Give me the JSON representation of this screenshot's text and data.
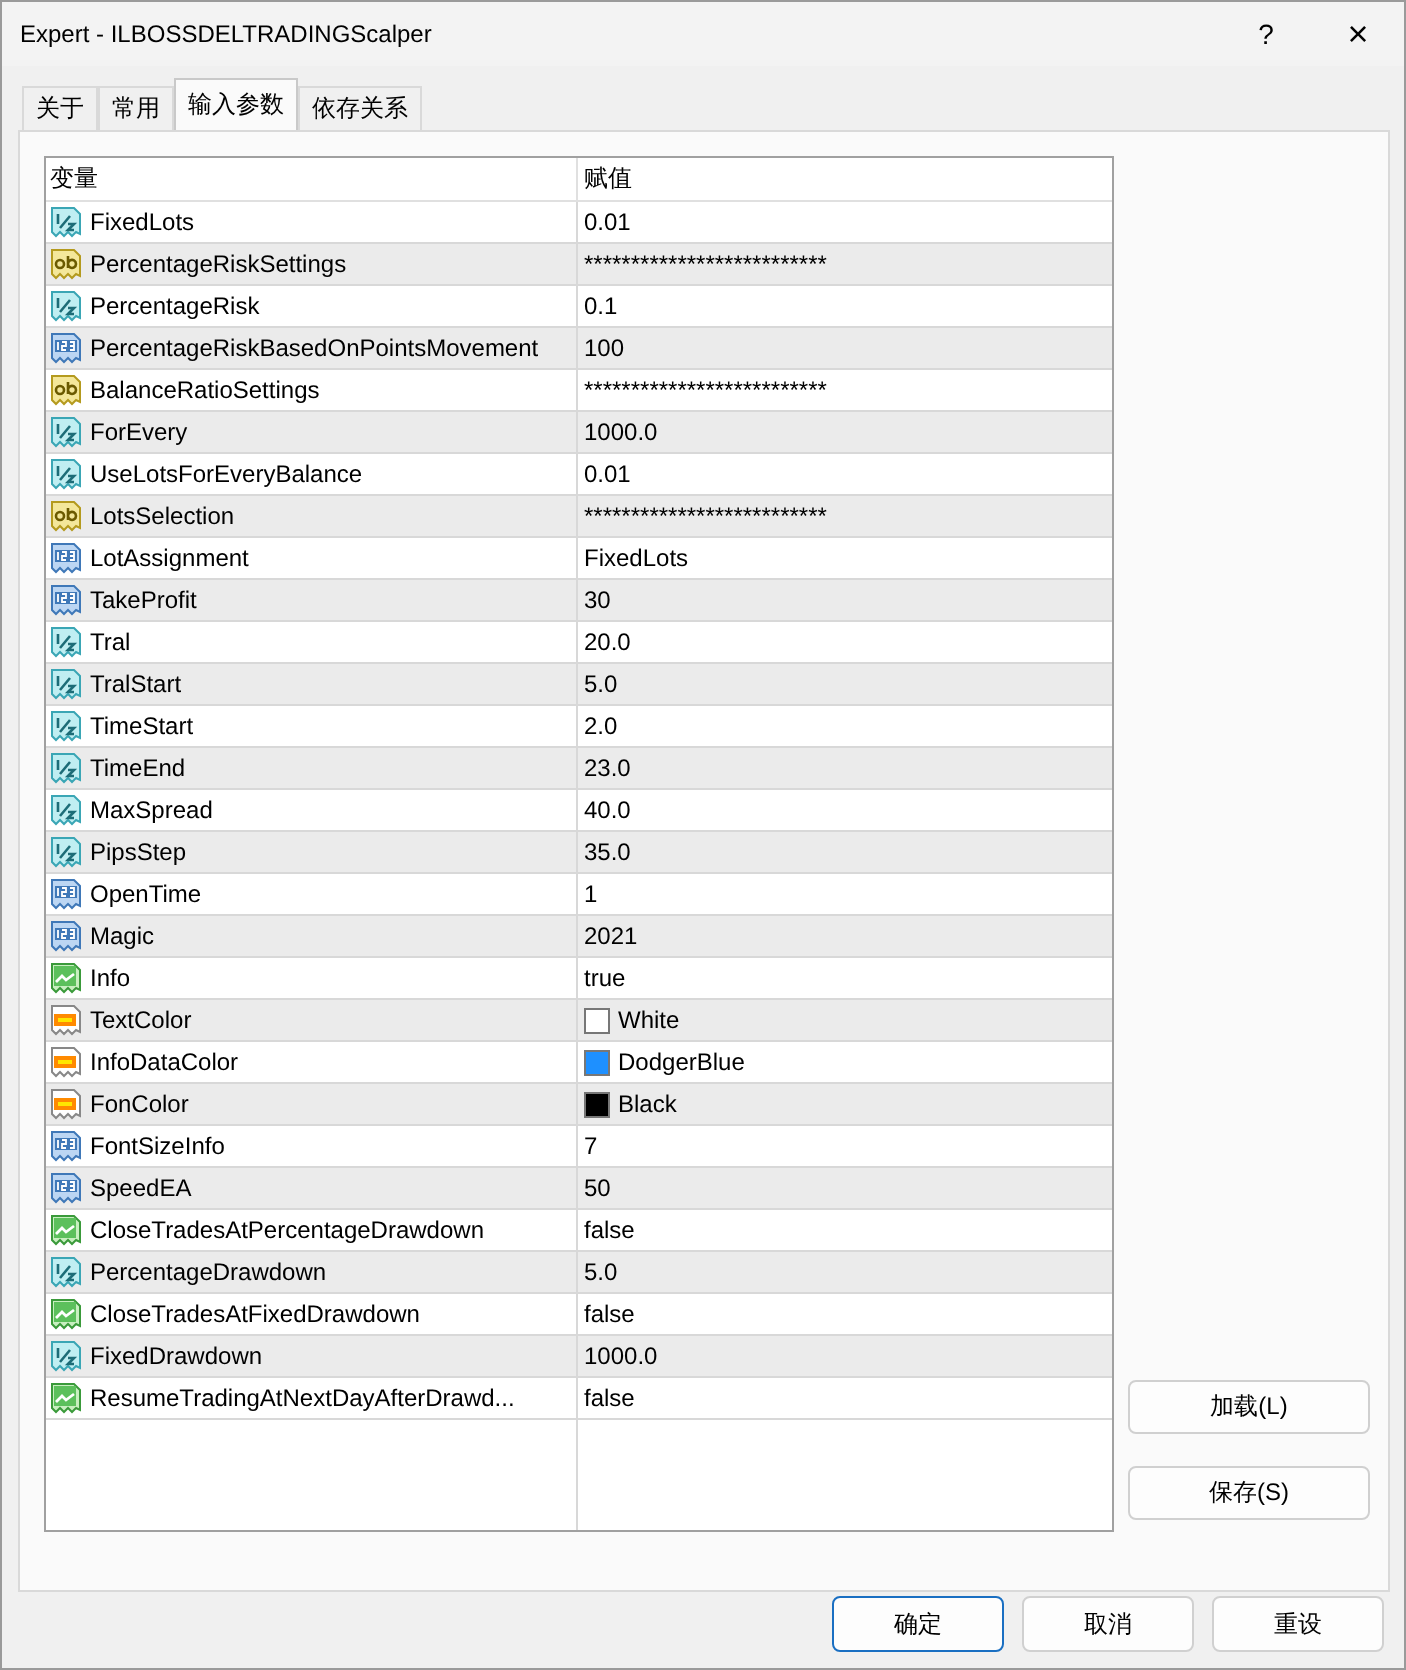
{
  "window": {
    "title": "Expert - ILBOSSDELTRADINGScalper",
    "help": "?",
    "close": "×"
  },
  "tabs": [
    {
      "label": "关于",
      "selected": false
    },
    {
      "label": "常用",
      "selected": false
    },
    {
      "label": "输入参数",
      "selected": true
    },
    {
      "label": "依存关系",
      "selected": false
    }
  ],
  "table": {
    "columns": [
      "变量",
      "赋值"
    ],
    "rows": [
      {
        "kind": "double",
        "name": "FixedLots",
        "value": "0.01"
      },
      {
        "kind": "string",
        "name": "PercentageRiskSettings",
        "value": "**************************"
      },
      {
        "kind": "double",
        "name": "PercentageRisk",
        "value": "0.1"
      },
      {
        "kind": "int",
        "name": "PercentageRiskBasedOnPointsMovement",
        "value": "100"
      },
      {
        "kind": "string",
        "name": "BalanceRatioSettings",
        "value": "**************************"
      },
      {
        "kind": "double",
        "name": "ForEvery",
        "value": "1000.0"
      },
      {
        "kind": "double",
        "name": "UseLotsForEveryBalance",
        "value": "0.01"
      },
      {
        "kind": "string",
        "name": "LotsSelection",
        "value": "**************************"
      },
      {
        "kind": "int",
        "name": "LotAssignment",
        "value": "FixedLots"
      },
      {
        "kind": "int",
        "name": "TakeProfit",
        "value": "30"
      },
      {
        "kind": "double",
        "name": "Tral",
        "value": "20.0"
      },
      {
        "kind": "double",
        "name": "TralStart",
        "value": "5.0"
      },
      {
        "kind": "double",
        "name": "TimeStart",
        "value": "2.0"
      },
      {
        "kind": "double",
        "name": "TimeEnd",
        "value": "23.0"
      },
      {
        "kind": "double",
        "name": "MaxSpread",
        "value": "40.0"
      },
      {
        "kind": "double",
        "name": "PipsStep",
        "value": "35.0"
      },
      {
        "kind": "int",
        "name": "OpenTime",
        "value": "1"
      },
      {
        "kind": "int",
        "name": "Magic",
        "value": "2021"
      },
      {
        "kind": "bool",
        "name": "Info",
        "value": "true"
      },
      {
        "kind": "color",
        "name": "TextColor",
        "value": "White",
        "color": "#ffffff"
      },
      {
        "kind": "color",
        "name": "InfoDataColor",
        "value": "DodgerBlue",
        "color": "#1e90ff"
      },
      {
        "kind": "color",
        "name": "FonColor",
        "value": "Black",
        "color": "#000000"
      },
      {
        "kind": "int",
        "name": "FontSizeInfo",
        "value": "7"
      },
      {
        "kind": "int",
        "name": "SpeedEA",
        "value": "50"
      },
      {
        "kind": "bool",
        "name": "CloseTradesAtPercentageDrawdown",
        "value": "false"
      },
      {
        "kind": "double",
        "name": "PercentageDrawdown",
        "value": "5.0"
      },
      {
        "kind": "bool",
        "name": "CloseTradesAtFixedDrawdown",
        "value": "false"
      },
      {
        "kind": "double",
        "name": "FixedDrawdown",
        "value": "1000.0"
      },
      {
        "kind": "bool",
        "name": "ResumeTradingAtNextDayAfterDrawd...",
        "value": "false"
      }
    ]
  },
  "side_buttons": [
    "加载(L)",
    "保存(S)"
  ],
  "buttons": [
    {
      "label": "确定",
      "default": true
    },
    {
      "label": "取消",
      "default": false
    },
    {
      "label": "重设",
      "default": false
    }
  ]
}
